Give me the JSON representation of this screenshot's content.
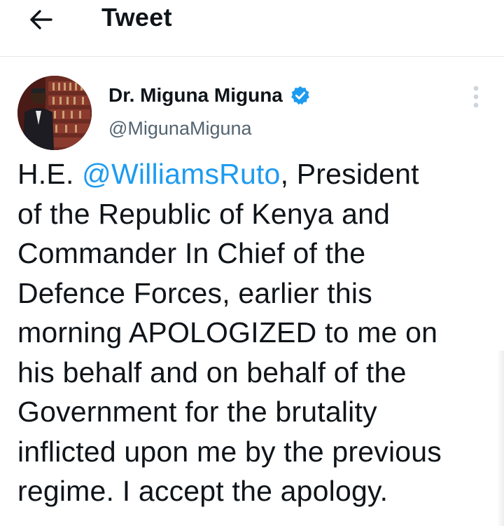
{
  "header": {
    "title": "Tweet",
    "back_icon": "arrow-left-icon"
  },
  "author": {
    "name": "Dr. Miguna Miguna",
    "handle": "@MigunaMiguna",
    "verified": true,
    "verified_color": "#1d9bf0"
  },
  "tweet": {
    "lines": [
      {
        "pre": "H.E. ",
        "mention": "@WilliamsRuto",
        "post": ", President"
      },
      {
        "text": "of the Republic of Kenya and"
      },
      {
        "text": "Commander In Chief of the"
      },
      {
        "text": "Defence Forces, earlier this"
      },
      {
        "text": "morning APOLOGIZED to me on"
      },
      {
        "text": "his behalf and on behalf of the"
      },
      {
        "text": "Government for the brutality"
      },
      {
        "text": "inflicted upon me by the previous"
      },
      {
        "text": "regime. I accept the apology."
      }
    ]
  },
  "colors": {
    "text": "#0f1419",
    "secondary": "#536471",
    "link": "#1d9bf0",
    "divider": "#e6e6e6"
  }
}
